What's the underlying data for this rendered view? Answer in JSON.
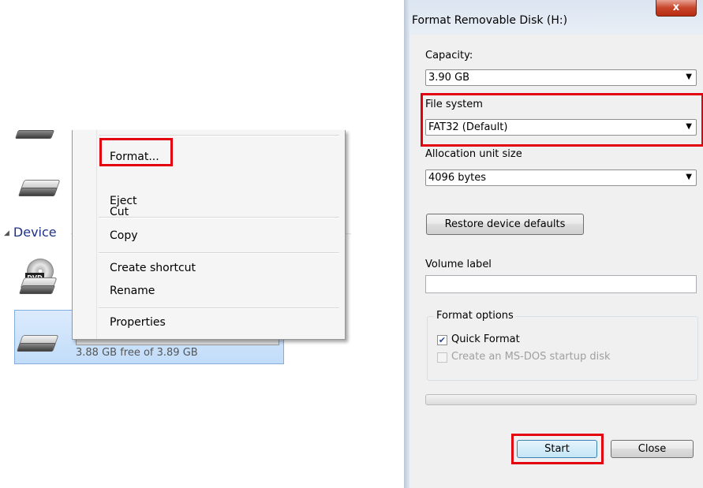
{
  "explorer": {
    "section_label": "Device",
    "free_space": "3.88 GB free of 3.89 GB",
    "dvd_label": "DVD"
  },
  "context_menu": {
    "items": [
      "Format...",
      "Eject",
      "Cut",
      "Copy",
      "Create shortcut",
      "Rename",
      "Properties"
    ]
  },
  "dialog": {
    "title": "Format Removable Disk (H:)",
    "close_symbol": "x",
    "capacity_label": "Capacity:",
    "capacity_value": "3.90 GB",
    "file_system_label": "File system",
    "file_system_value": "FAT32 (Default)",
    "allocation_label": "Allocation unit size",
    "allocation_value": "4096 bytes",
    "restore_button": "Restore device defaults",
    "volume_label": "Volume label",
    "volume_value": "",
    "format_options_label": "Format options",
    "quick_format_label": "Quick Format",
    "quick_format_checked": true,
    "msdos_label": "Create an MS-DOS startup disk",
    "msdos_checked": false,
    "start_button": "Start",
    "close_button": "Close"
  },
  "colors": {
    "highlight": "#e3000f",
    "selection": "#c1dcfa",
    "section_text": "#1e3287"
  },
  "icons": [
    "hard-drive-icon",
    "dvd-drive-icon",
    "check-icon",
    "dropdown-arrow-icon",
    "close-icon",
    "collapse-triangle-icon"
  ]
}
